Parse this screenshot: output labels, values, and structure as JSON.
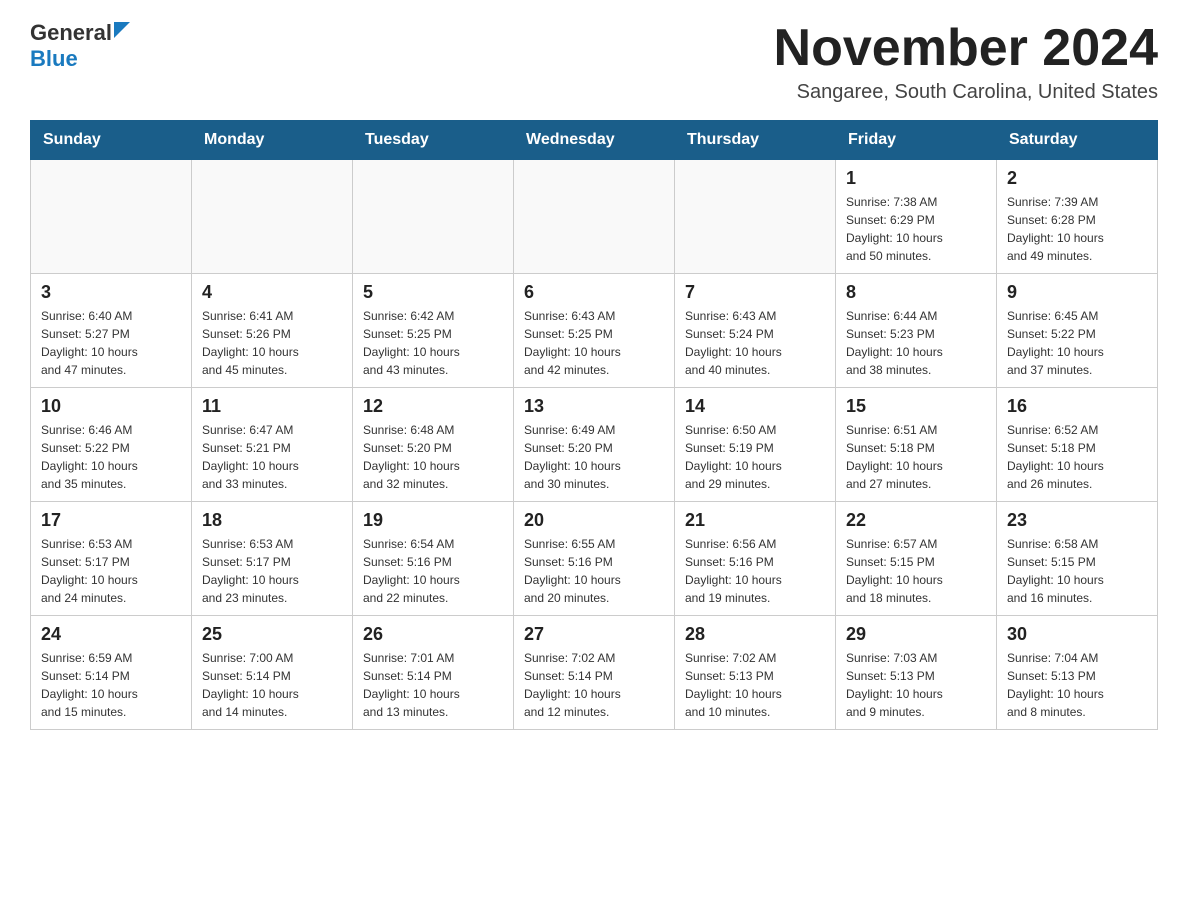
{
  "logo": {
    "general": "General",
    "blue": "Blue"
  },
  "title": "November 2024",
  "subtitle": "Sangaree, South Carolina, United States",
  "weekdays": [
    "Sunday",
    "Monday",
    "Tuesday",
    "Wednesday",
    "Thursday",
    "Friday",
    "Saturday"
  ],
  "weeks": [
    [
      {
        "day": "",
        "info": ""
      },
      {
        "day": "",
        "info": ""
      },
      {
        "day": "",
        "info": ""
      },
      {
        "day": "",
        "info": ""
      },
      {
        "day": "",
        "info": ""
      },
      {
        "day": "1",
        "info": "Sunrise: 7:38 AM\nSunset: 6:29 PM\nDaylight: 10 hours\nand 50 minutes."
      },
      {
        "day": "2",
        "info": "Sunrise: 7:39 AM\nSunset: 6:28 PM\nDaylight: 10 hours\nand 49 minutes."
      }
    ],
    [
      {
        "day": "3",
        "info": "Sunrise: 6:40 AM\nSunset: 5:27 PM\nDaylight: 10 hours\nand 47 minutes."
      },
      {
        "day": "4",
        "info": "Sunrise: 6:41 AM\nSunset: 5:26 PM\nDaylight: 10 hours\nand 45 minutes."
      },
      {
        "day": "5",
        "info": "Sunrise: 6:42 AM\nSunset: 5:25 PM\nDaylight: 10 hours\nand 43 minutes."
      },
      {
        "day": "6",
        "info": "Sunrise: 6:43 AM\nSunset: 5:25 PM\nDaylight: 10 hours\nand 42 minutes."
      },
      {
        "day": "7",
        "info": "Sunrise: 6:43 AM\nSunset: 5:24 PM\nDaylight: 10 hours\nand 40 minutes."
      },
      {
        "day": "8",
        "info": "Sunrise: 6:44 AM\nSunset: 5:23 PM\nDaylight: 10 hours\nand 38 minutes."
      },
      {
        "day": "9",
        "info": "Sunrise: 6:45 AM\nSunset: 5:22 PM\nDaylight: 10 hours\nand 37 minutes."
      }
    ],
    [
      {
        "day": "10",
        "info": "Sunrise: 6:46 AM\nSunset: 5:22 PM\nDaylight: 10 hours\nand 35 minutes."
      },
      {
        "day": "11",
        "info": "Sunrise: 6:47 AM\nSunset: 5:21 PM\nDaylight: 10 hours\nand 33 minutes."
      },
      {
        "day": "12",
        "info": "Sunrise: 6:48 AM\nSunset: 5:20 PM\nDaylight: 10 hours\nand 32 minutes."
      },
      {
        "day": "13",
        "info": "Sunrise: 6:49 AM\nSunset: 5:20 PM\nDaylight: 10 hours\nand 30 minutes."
      },
      {
        "day": "14",
        "info": "Sunrise: 6:50 AM\nSunset: 5:19 PM\nDaylight: 10 hours\nand 29 minutes."
      },
      {
        "day": "15",
        "info": "Sunrise: 6:51 AM\nSunset: 5:18 PM\nDaylight: 10 hours\nand 27 minutes."
      },
      {
        "day": "16",
        "info": "Sunrise: 6:52 AM\nSunset: 5:18 PM\nDaylight: 10 hours\nand 26 minutes."
      }
    ],
    [
      {
        "day": "17",
        "info": "Sunrise: 6:53 AM\nSunset: 5:17 PM\nDaylight: 10 hours\nand 24 minutes."
      },
      {
        "day": "18",
        "info": "Sunrise: 6:53 AM\nSunset: 5:17 PM\nDaylight: 10 hours\nand 23 minutes."
      },
      {
        "day": "19",
        "info": "Sunrise: 6:54 AM\nSunset: 5:16 PM\nDaylight: 10 hours\nand 22 minutes."
      },
      {
        "day": "20",
        "info": "Sunrise: 6:55 AM\nSunset: 5:16 PM\nDaylight: 10 hours\nand 20 minutes."
      },
      {
        "day": "21",
        "info": "Sunrise: 6:56 AM\nSunset: 5:16 PM\nDaylight: 10 hours\nand 19 minutes."
      },
      {
        "day": "22",
        "info": "Sunrise: 6:57 AM\nSunset: 5:15 PM\nDaylight: 10 hours\nand 18 minutes."
      },
      {
        "day": "23",
        "info": "Sunrise: 6:58 AM\nSunset: 5:15 PM\nDaylight: 10 hours\nand 16 minutes."
      }
    ],
    [
      {
        "day": "24",
        "info": "Sunrise: 6:59 AM\nSunset: 5:14 PM\nDaylight: 10 hours\nand 15 minutes."
      },
      {
        "day": "25",
        "info": "Sunrise: 7:00 AM\nSunset: 5:14 PM\nDaylight: 10 hours\nand 14 minutes."
      },
      {
        "day": "26",
        "info": "Sunrise: 7:01 AM\nSunset: 5:14 PM\nDaylight: 10 hours\nand 13 minutes."
      },
      {
        "day": "27",
        "info": "Sunrise: 7:02 AM\nSunset: 5:14 PM\nDaylight: 10 hours\nand 12 minutes."
      },
      {
        "day": "28",
        "info": "Sunrise: 7:02 AM\nSunset: 5:13 PM\nDaylight: 10 hours\nand 10 minutes."
      },
      {
        "day": "29",
        "info": "Sunrise: 7:03 AM\nSunset: 5:13 PM\nDaylight: 10 hours\nand 9 minutes."
      },
      {
        "day": "30",
        "info": "Sunrise: 7:04 AM\nSunset: 5:13 PM\nDaylight: 10 hours\nand 8 minutes."
      }
    ]
  ]
}
